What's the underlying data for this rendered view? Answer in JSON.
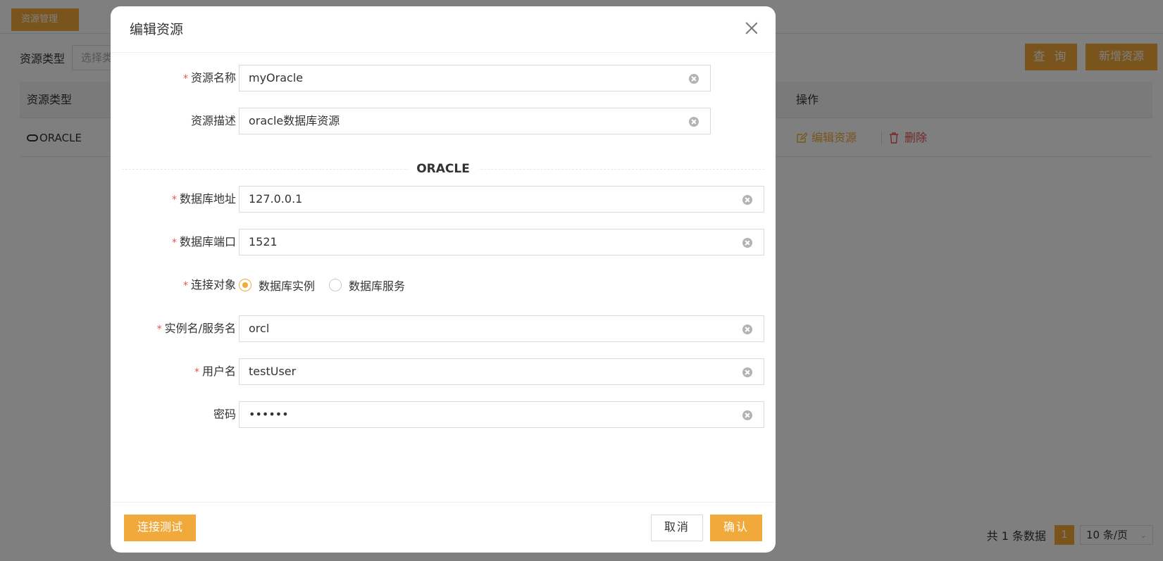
{
  "page": {
    "tab": "资源管理",
    "search": {
      "label": "资源类型",
      "placeholder": "选择类型"
    },
    "buttons": {
      "query": "查 询",
      "add": "新增资源"
    },
    "table": {
      "headers": {
        "type": "资源类型",
        "ops": "操作"
      },
      "rows": [
        {
          "type": "ORACLE",
          "edit": "编辑资源",
          "delete": "删除"
        }
      ]
    },
    "pagination": {
      "total": "共 1 条数据",
      "current": "1",
      "page_size": "10 条/页"
    }
  },
  "dialog": {
    "title": "编辑资源",
    "fields": {
      "name": {
        "label": "资源名称",
        "value": "myOracle",
        "required": true
      },
      "desc": {
        "label": "资源描述",
        "value": "oracle数据库资源",
        "required": false
      },
      "section": "ORACLE",
      "host": {
        "label": "数据库地址",
        "value": "127.0.0.1",
        "required": true
      },
      "port": {
        "label": "数据库端口",
        "value": "1521",
        "required": true
      },
      "conn": {
        "label": "连接对象",
        "options": [
          "数据库实例",
          "数据库服务"
        ],
        "selected": "数据库实例",
        "required": true
      },
      "instance": {
        "label": "实例名/服务名",
        "value": "orcl",
        "required": true
      },
      "user": {
        "label": "用户名",
        "value": "testUser",
        "required": true
      },
      "password": {
        "label": "密码",
        "value": "••••••",
        "required": false
      }
    },
    "footer": {
      "test": "连接测试",
      "cancel": "取消",
      "ok": "确认"
    }
  },
  "colors": {
    "accent": "#f2a93b",
    "danger": "#e55353"
  }
}
